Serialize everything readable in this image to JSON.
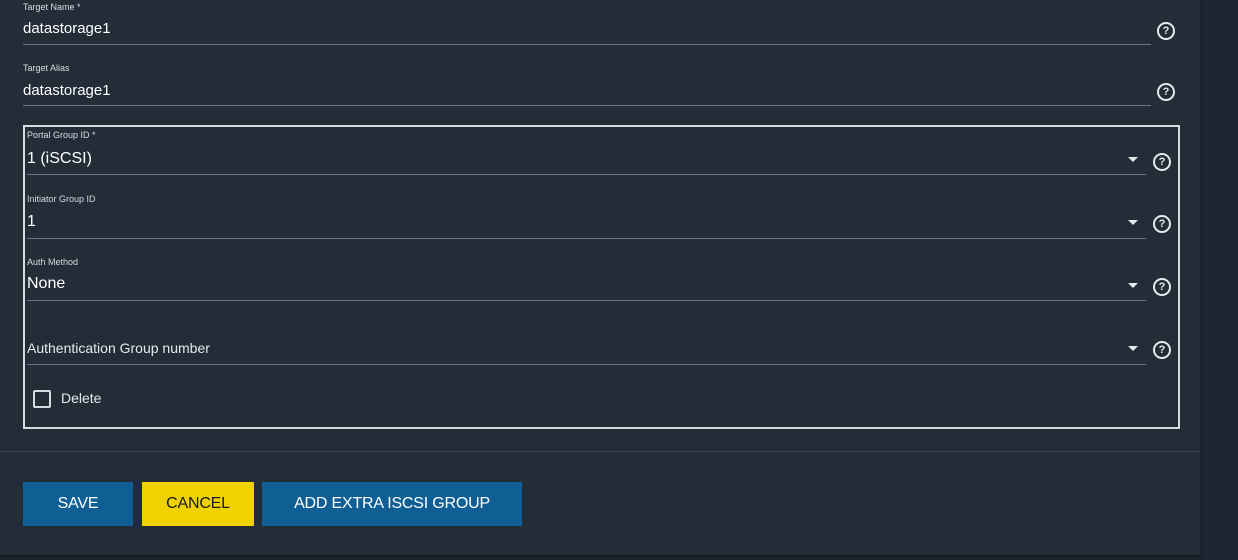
{
  "form": {
    "target_name": {
      "label": "Target Name *",
      "value": "datastorage1"
    },
    "target_alias": {
      "label": "Target Alias",
      "value": "datastorage1"
    },
    "group": {
      "portal_group": {
        "label": "Portal Group ID *",
        "value": "1 (iSCSI)"
      },
      "initiator_group": {
        "label": "Initiator Group ID",
        "value": "1"
      },
      "auth_method": {
        "label": "Auth Method",
        "value": "None"
      },
      "auth_group": {
        "placeholder": "Authentication Group number"
      },
      "delete": {
        "label": "Delete",
        "checked": false
      }
    }
  },
  "buttons": {
    "save": "SAVE",
    "cancel": "CANCEL",
    "add_extra": "ADD EXTRA ISCSI GROUP"
  },
  "icons": {
    "help": "?",
    "dropdown": "caret-down"
  },
  "colors": {
    "page_bg": "#1e2530",
    "card_bg": "#232d38",
    "primary": "#0f5f95",
    "accent": "#f0d200"
  }
}
